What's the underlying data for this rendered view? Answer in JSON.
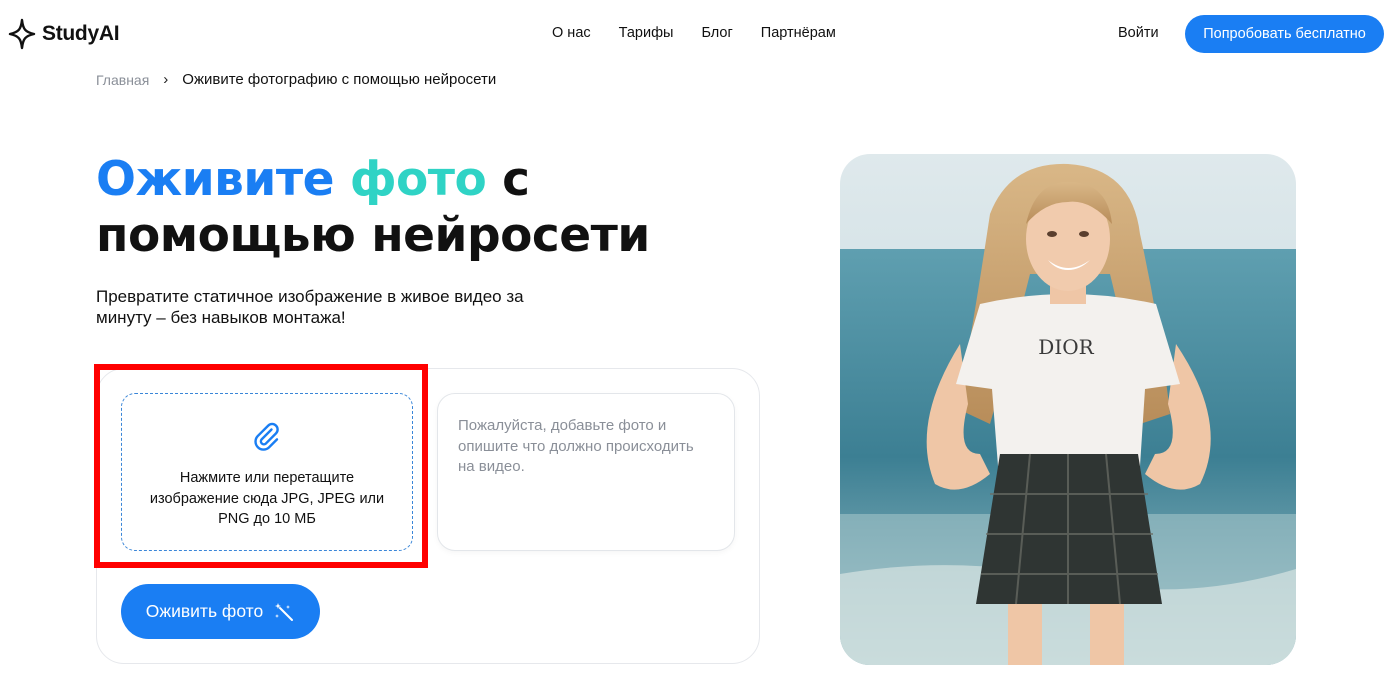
{
  "header": {
    "logo_text": "StudyAI",
    "nav": [
      "О нас",
      "Тарифы",
      "Блог",
      "Партнёрам"
    ],
    "login_label": "Войти",
    "try_label": "Попробовать бесплатно"
  },
  "breadcrumb": {
    "home": "Главная",
    "separator": "›",
    "current": "Оживите фотографию с помощью нейросети"
  },
  "hero": {
    "title_part1": "Оживите",
    "title_part2": "фото",
    "title_part3": "с помощью нейросети",
    "subtitle": "Превратите статичное изображение в живое видео за минуту – без навыков монтажа!"
  },
  "form": {
    "upload_text": "Нажмите или перетащите изображение сюда JPG, JPEG или PNG до 10 МБ",
    "upload_icon": "paperclip-icon",
    "prompt_placeholder": "Пожалуйста, добавьте фото и опишите что должно происходить на видео.",
    "submit_label": "Оживить фото",
    "submit_icon": "magic-wand-icon"
  },
  "image": {
    "shirt_text": "DIOR"
  },
  "colors": {
    "accent": "#1a7ef3",
    "teal": "#2fd3c5",
    "highlight": "#ff0000"
  }
}
